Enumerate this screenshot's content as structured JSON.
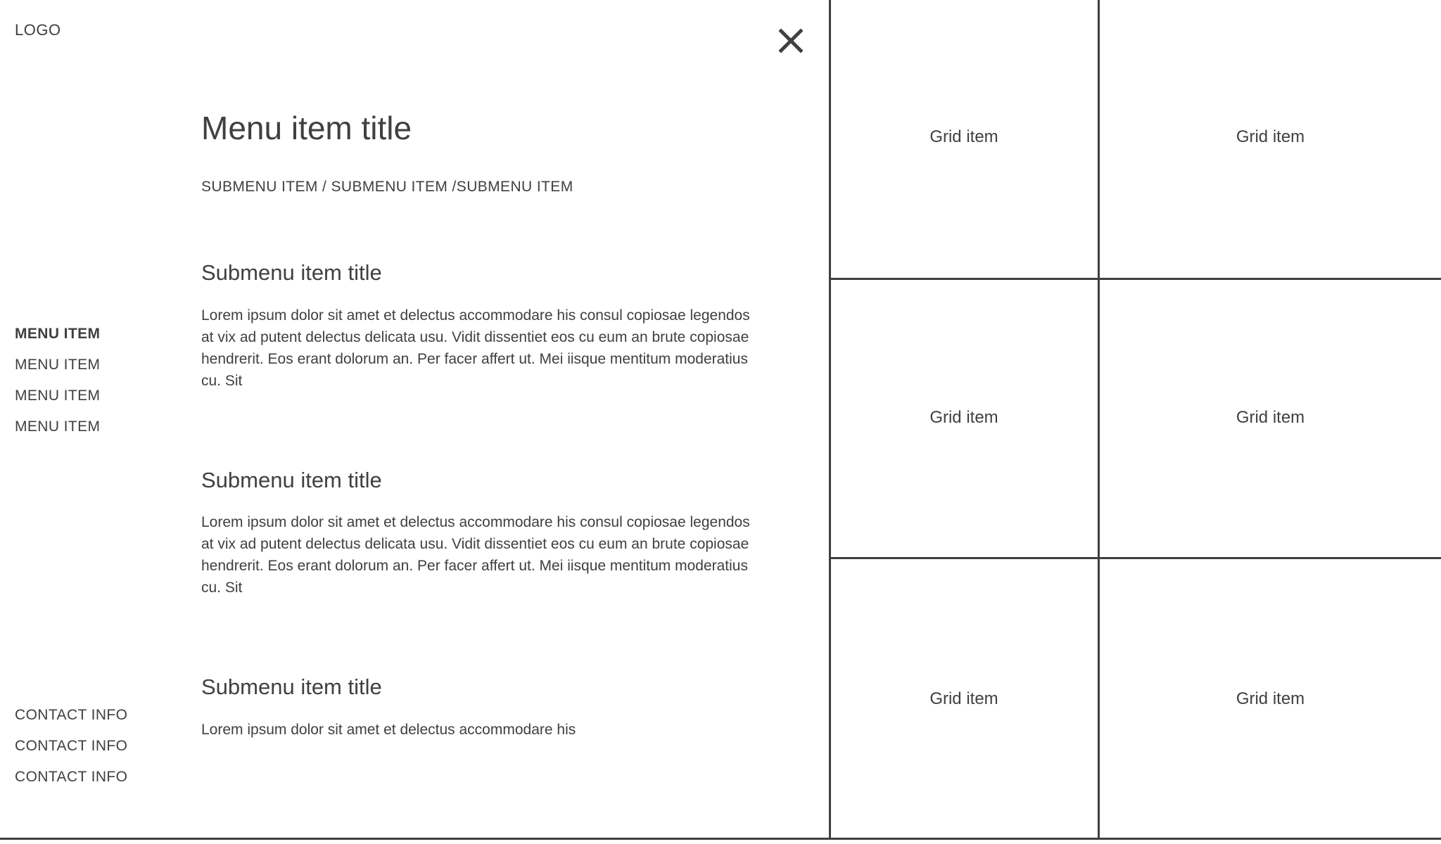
{
  "brand": {
    "logo": "LOGO"
  },
  "header": {
    "close_icon": "close-icon",
    "close_label": "Close"
  },
  "sidebar": {
    "menu_items": [
      {
        "label": "MENU ITEM",
        "active": true
      },
      {
        "label": "MENU ITEM",
        "active": false
      },
      {
        "label": "MENU ITEM",
        "active": false
      },
      {
        "label": "MENU ITEM",
        "active": false
      }
    ],
    "contact_items": [
      {
        "label": "CONTACT INFO"
      },
      {
        "label": "CONTACT INFO"
      },
      {
        "label": "CONTACT INFO"
      }
    ]
  },
  "main": {
    "title": "Menu item title",
    "breadcrumb": "SUBMENU ITEM / SUBMENU ITEM /SUBMENU ITEM",
    "sections": [
      {
        "title": "Submenu item title",
        "body": "Lorem ipsum dolor sit amet et delectus accommodare his consul copiosae legendos at vix ad putent delectus delicata usu. Vidit dissentiet eos cu eum an brute copiosae hendrerit. Eos erant dolorum an. Per facer affert ut. Mei iisque mentitum moderatius cu. Sit"
      },
      {
        "title": "Submenu item title",
        "body": "Lorem ipsum dolor sit amet et delectus accommodare his consul copiosae legendos at vix ad putent delectus delicata usu. Vidit dissentiet eos cu eum an brute copiosae hendrerit. Eos erant dolorum an. Per facer affert ut. Mei iisque mentitum moderatius cu. Sit"
      },
      {
        "title": "Submenu item title",
        "body": "Lorem ipsum dolor sit amet et delectus accommodare his"
      }
    ]
  },
  "grid": {
    "rows": [
      {
        "left": "Grid item",
        "right": "Grid item"
      },
      {
        "left": "Grid item",
        "right": "Grid item"
      },
      {
        "left": "Grid item",
        "right": "Grid item"
      }
    ]
  },
  "colors": {
    "text": "#404040",
    "rule": "#3f3f3f",
    "background": "#ffffff"
  }
}
